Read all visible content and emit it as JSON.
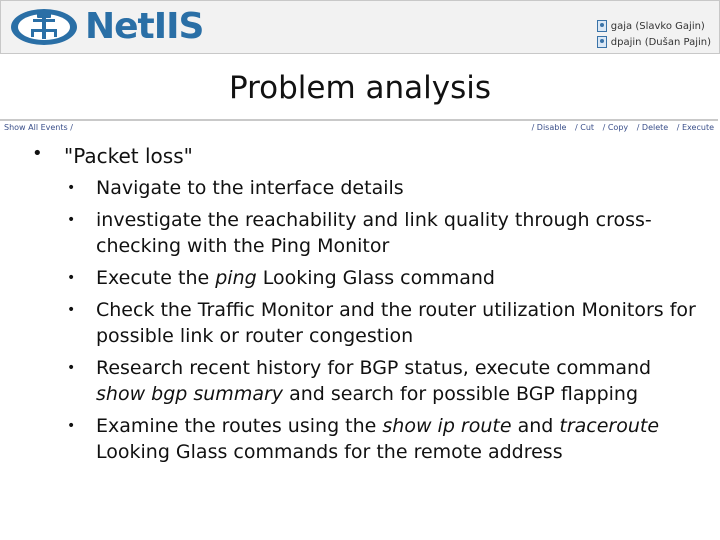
{
  "header": {
    "brand": "NetIIS",
    "users": [
      {
        "label": "gaja (Slavko Gajin)"
      },
      {
        "label": "dpajin (Dušan Pajin)"
      }
    ]
  },
  "page": {
    "title": "Problem analysis"
  },
  "toolbar": {
    "show_all": "Show All Events /",
    "actions": [
      "/ Disable",
      "/ Cut",
      "/ Copy",
      "/ Delete",
      "/ Execute"
    ]
  },
  "content": {
    "main_item": "\"Packet loss\"",
    "steps": [
      {
        "parts": [
          "Navigate to the interface details"
        ]
      },
      {
        "parts": [
          "investigate the reachability and link quality through cross-checking with the Ping Monitor"
        ]
      },
      {
        "parts": [
          "Execute the ",
          "ping",
          " Looking Glass command"
        ]
      },
      {
        "parts": [
          "Check the Traffic Monitor and the router utilization Monitors for possible link or router congestion"
        ]
      },
      {
        "parts": [
          "Research recent history for BGP status, execute command ",
          "show bgp summary",
          " and search for possible BGP flapping"
        ]
      },
      {
        "parts": [
          "Examine the routes using the ",
          "show ip route",
          " and ",
          "traceroute",
          " Looking Glass commands for the remote address"
        ]
      }
    ]
  }
}
